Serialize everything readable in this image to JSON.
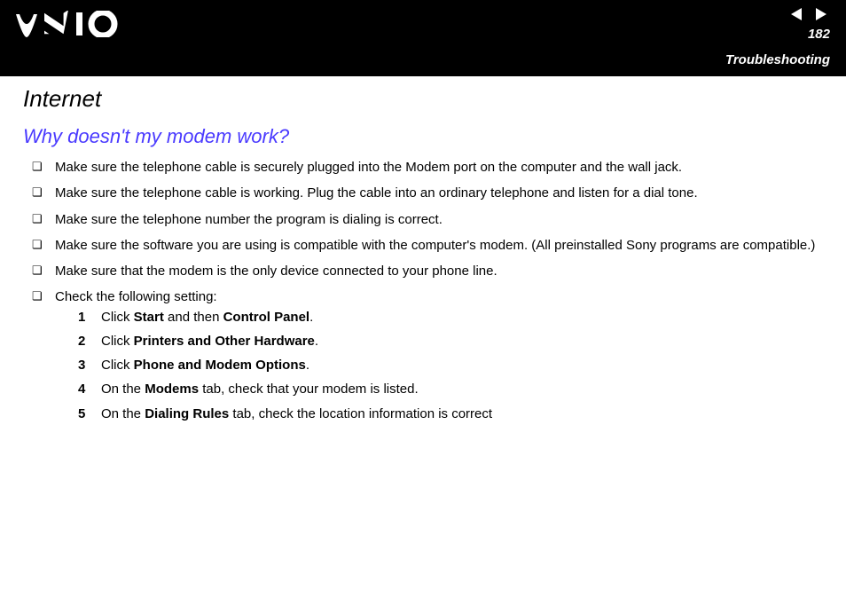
{
  "header": {
    "page_number": "182",
    "section": "Troubleshooting"
  },
  "content": {
    "title": "Internet",
    "subtitle": "Why doesn't my modem work?",
    "bullets": [
      "Make sure the telephone cable is securely plugged into the Modem port on the computer and the wall jack.",
      "Make sure the telephone cable is working. Plug the cable into an ordinary telephone and listen for a dial tone.",
      "Make sure the telephone number the program is dialing is correct.",
      "Make sure the software you are using is compatible with the computer's modem. (All preinstalled Sony programs are compatible.)",
      "Make sure that the modem is the only device connected to your phone line.",
      "Check the following setting:"
    ],
    "steps": [
      {
        "n": "1",
        "pre": "Click ",
        "b1": "Start",
        "mid": " and then ",
        "b2": "Control Panel",
        "post": "."
      },
      {
        "n": "2",
        "pre": "Click ",
        "b1": "Printers and Other Hardware",
        "mid": "",
        "b2": "",
        "post": "."
      },
      {
        "n": "3",
        "pre": "Click ",
        "b1": "Phone and Modem Options",
        "mid": "",
        "b2": "",
        "post": "."
      },
      {
        "n": "4",
        "pre": "On the ",
        "b1": "Modems",
        "mid": " tab, check that your modem is listed.",
        "b2": "",
        "post": ""
      },
      {
        "n": "5",
        "pre": "On the ",
        "b1": "Dialing Rules",
        "mid": " tab, check the location information is correct",
        "b2": "",
        "post": ""
      }
    ]
  }
}
